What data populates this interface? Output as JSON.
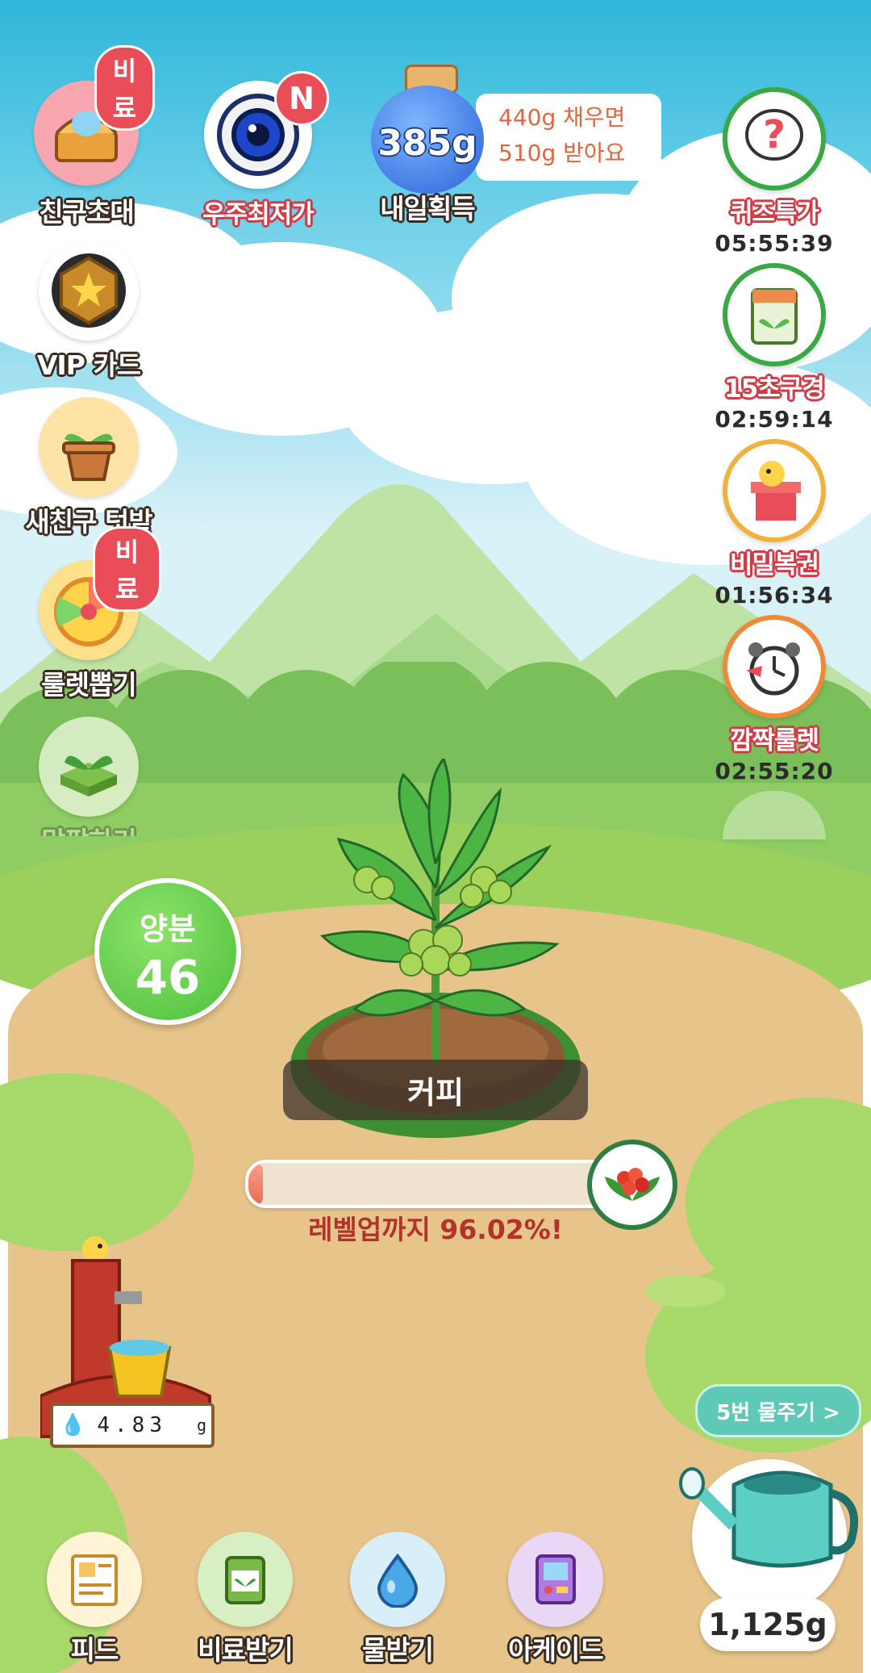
{
  "top_buttons": {
    "invite": {
      "label": "친구초대",
      "badge": "비료"
    },
    "space_lowest": {
      "label": "우주최저가",
      "badge": "N"
    },
    "tomorrow_gain": {
      "amount": "385g",
      "label": "내일획득",
      "line1": "440g 채우면",
      "line2": "510g 받아요"
    }
  },
  "left_menu": [
    {
      "label": "VIP 카드"
    },
    {
      "label": "새친구 텃밭"
    },
    {
      "label": "룰렛뽑기",
      "badge": "비료"
    },
    {
      "label": "맞팜하기"
    }
  ],
  "right_menu": [
    {
      "label": "퀴즈특가",
      "timer": "05:55:39"
    },
    {
      "label": "15초구경",
      "timer": "02:59:14"
    },
    {
      "label": "비밀복권",
      "timer": "01:56:34"
    },
    {
      "label": "깜짝룰렛",
      "timer": "02:55:20"
    }
  ],
  "nutrient": {
    "label": "양분",
    "value": "46"
  },
  "plant": {
    "name": "커피",
    "progress_percent": 3.98,
    "progress_text": "레벨업까지 96.02%!"
  },
  "well": {
    "water": "4.83",
    "unit": "g"
  },
  "watering": {
    "count_button": "5번 물주기 >",
    "amount": "1,125g"
  },
  "bottom_nav": [
    {
      "label": "피드"
    },
    {
      "label": "비료받기"
    },
    {
      "label": "물받기"
    },
    {
      "label": "아케이드"
    }
  ]
}
